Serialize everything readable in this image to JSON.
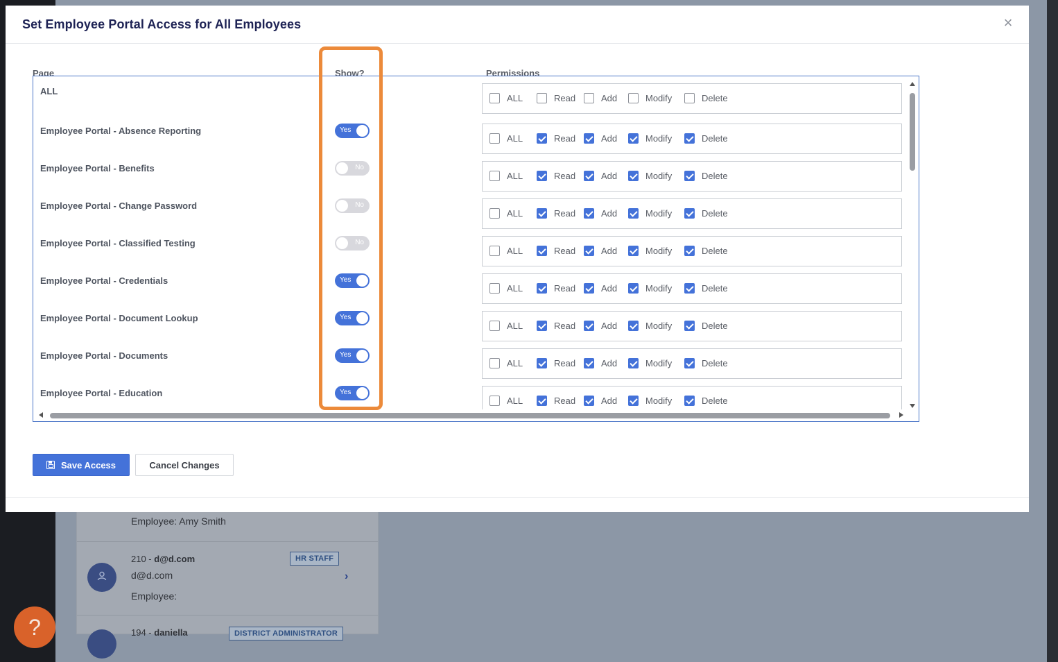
{
  "background": {
    "card": {
      "row1_text": "Employee: Amy Smith",
      "row2": {
        "avatar_icon": "user-icon",
        "title_prefix": "210 - ",
        "title": "d@d.com",
        "subtitle": "d@d.com",
        "employee": "Employee:",
        "badge": "HR STAFF",
        "chevron": "›"
      },
      "row3": {
        "title_prefix": "194 - ",
        "title": "daniella",
        "badge": "DISTRICT ADMINISTRATOR"
      }
    },
    "help_label": "?"
  },
  "modal": {
    "title": "Set Employee Portal Access for All Employees",
    "close_label": "×",
    "columns": {
      "page": "Page",
      "show": "Show?",
      "permissions": "Permissions"
    },
    "permission_labels": [
      "ALL",
      "Read",
      "Add",
      "Modify",
      "Delete"
    ],
    "rows": [
      {
        "page": "ALL",
        "show": null,
        "perms": {
          "all": false,
          "read": false,
          "add": false,
          "modify": false,
          "delete": false
        }
      },
      {
        "page": "Employee Portal - Absence Reporting",
        "show": "Yes",
        "perms": {
          "all": false,
          "read": true,
          "add": true,
          "modify": true,
          "delete": true
        }
      },
      {
        "page": "Employee Portal - Benefits",
        "show": "No",
        "perms": {
          "all": false,
          "read": true,
          "add": true,
          "modify": true,
          "delete": true
        }
      },
      {
        "page": "Employee Portal - Change Password",
        "show": "No",
        "perms": {
          "all": false,
          "read": true,
          "add": true,
          "modify": true,
          "delete": true
        }
      },
      {
        "page": "Employee Portal - Classified Testing",
        "show": "No",
        "perms": {
          "all": false,
          "read": true,
          "add": true,
          "modify": true,
          "delete": true
        }
      },
      {
        "page": "Employee Portal - Credentials",
        "show": "Yes",
        "perms": {
          "all": false,
          "read": true,
          "add": true,
          "modify": true,
          "delete": true
        }
      },
      {
        "page": "Employee Portal - Document Lookup",
        "show": "Yes",
        "perms": {
          "all": false,
          "read": true,
          "add": true,
          "modify": true,
          "delete": true
        }
      },
      {
        "page": "Employee Portal - Documents",
        "show": "Yes",
        "perms": {
          "all": false,
          "read": true,
          "add": true,
          "modify": true,
          "delete": true
        }
      },
      {
        "page": "Employee Portal - Education",
        "show": "Yes",
        "perms": {
          "all": false,
          "read": true,
          "add": true,
          "modify": true,
          "delete": true
        }
      }
    ],
    "save_label": "Save Access",
    "save_icon": "save-icon",
    "cancel_label": "Cancel Changes",
    "highlight_color": "#ec8a3a",
    "accent_color": "#4472d9"
  }
}
